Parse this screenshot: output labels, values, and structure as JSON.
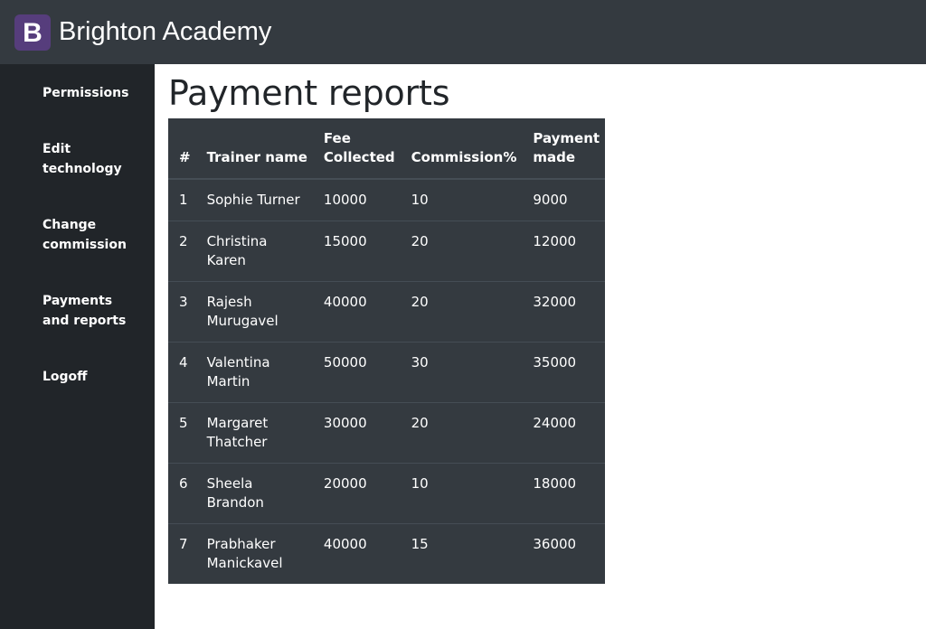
{
  "brand": {
    "logo_letter": "B",
    "name": "Brighton Academy",
    "logo_color": "#563d7c"
  },
  "sidebar": {
    "items": [
      {
        "label": "Permissions"
      },
      {
        "label": "Edit technology"
      },
      {
        "label": "Change commission"
      },
      {
        "label": "Payments and reports"
      },
      {
        "label": "Logoff"
      }
    ]
  },
  "main": {
    "title": "Payment reports",
    "table": {
      "headers": [
        "#",
        "Trainer name",
        "Fee Collected",
        "Commission%",
        "Payment made"
      ],
      "rows": [
        [
          "1",
          "Sophie Turner",
          "10000",
          "10",
          "9000"
        ],
        [
          "2",
          "Christina Karen",
          "15000",
          "20",
          "12000"
        ],
        [
          "3",
          "Rajesh Murugavel",
          "40000",
          "20",
          "32000"
        ],
        [
          "4",
          "Valentina Martin",
          "50000",
          "30",
          "35000"
        ],
        [
          "5",
          "Margaret Thatcher",
          "30000",
          "20",
          "24000"
        ],
        [
          "6",
          "Sheela Brandon",
          "20000",
          "10",
          "18000"
        ],
        [
          "7",
          "Prabhaker Manickavel",
          "40000",
          "15",
          "36000"
        ]
      ]
    }
  },
  "colors": {
    "topbar": "#343a40",
    "sidebar": "#212529",
    "table_bg": "#343a40",
    "table_border": "#454d55"
  }
}
